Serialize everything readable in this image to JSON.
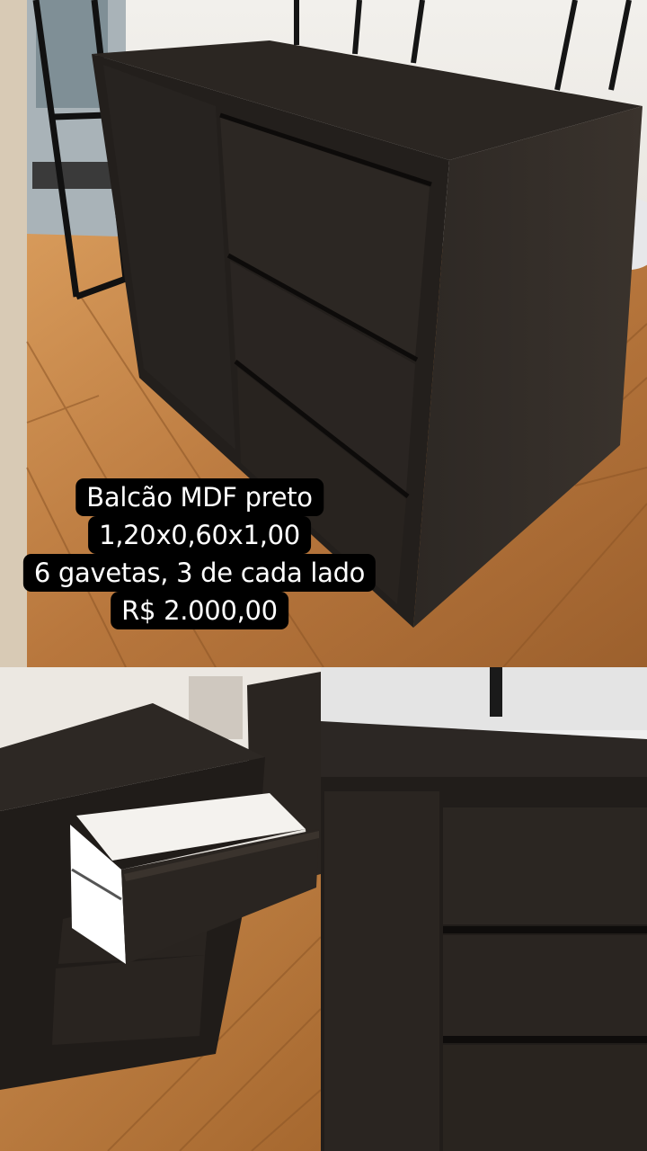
{
  "caption": {
    "line1": "Balcão MDF preto",
    "line2": "1,20x0,60x1,00",
    "line3": "6 gavetas, 3 de cada lado",
    "line4": "R$ 2.000,00"
  },
  "colors": {
    "cabinet": "#2a2521",
    "floor": "#b9793f",
    "caption_bg": "#000000",
    "caption_text": "#ffffff"
  },
  "images": {
    "top": "black-mdf-counter-front-view-photo",
    "bottom_left": "counter-open-drawer-photo",
    "bottom_right": "counter-drawers-closeup-photo"
  }
}
